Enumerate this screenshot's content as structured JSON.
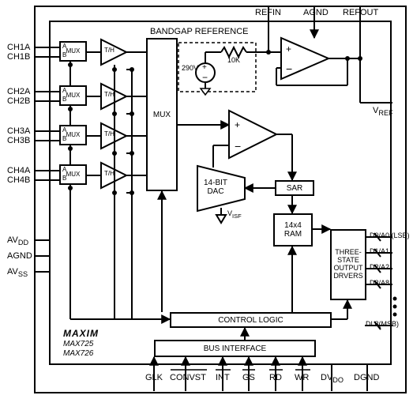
{
  "title": "BANDGAP REFERENCE",
  "pins_top": {
    "refin": "REFIN",
    "agnd": "AGND",
    "refout": "REFOUT"
  },
  "pins_left": {
    "ch1a": "CH1A",
    "ch1b": "CH1B",
    "ch2a": "CH2A",
    "ch2b": "CH2B",
    "ch3a": "CH3A",
    "ch3b": "CH3B",
    "ch4a": "CH4A",
    "ch4b": "CH4B",
    "avdd": "AV",
    "avdd_sub": "DD",
    "agnd": "AGND",
    "avss": "AV",
    "avss_sub": "SS"
  },
  "pins_right": {
    "d0": "D0/A0 (LSB)",
    "d1": "D1/A1",
    "d2": "D2/A2",
    "d8": "D8/A8",
    "dl8": "DL8(MSB)",
    "vref": "V",
    "vref_sub": "REF"
  },
  "pins_bottom": {
    "glk": "GLK",
    "convst": "CONVST",
    "int": "INT",
    "gs": "GS",
    "rd": "RD",
    "wr": "WR",
    "dvdo": "DV",
    "dvdo_sub": "DO",
    "dgnd": "DGND"
  },
  "blocks": {
    "amux": "MUX",
    "amux_a": "A",
    "amux_b": "B",
    "th": "T/H",
    "mux": "MUX",
    "dac": "14-BIT\nDAC",
    "sar": "SAR",
    "ram": "14x4\nRAM",
    "drivers": "THREE-\nSTATE\nOUTPUT\nDRVERS",
    "control": "CONTROL LOGIC",
    "bus": "BUS INTERFACE",
    "src_val": "290V",
    "r_val": "10K",
    "visf": "V",
    "visf_sub": "ISF"
  },
  "branding": {
    "logo": "MAXIM",
    "p1": "MAX725",
    "p2": "MAX726"
  }
}
